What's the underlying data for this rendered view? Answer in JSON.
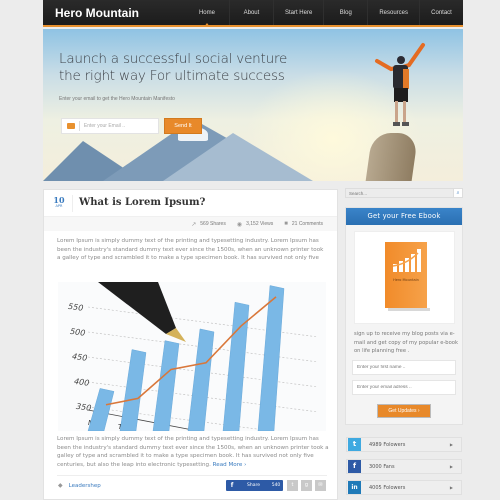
{
  "header": {
    "logo": "Hero Mountain",
    "nav": [
      {
        "label": "Home",
        "active": true
      },
      {
        "label": "About",
        "active": false
      },
      {
        "label": "Start Here",
        "active": false
      },
      {
        "label": "Blog",
        "active": false
      },
      {
        "label": "Resources",
        "active": false
      },
      {
        "label": "Contact",
        "active": false
      }
    ],
    "accent": "#e8912e"
  },
  "hero": {
    "title_line1": "Launch a successful social venture",
    "title_line2": "the right way For ultimate success",
    "subtitle": "Enter your email to get the Hero Mountain Manifesto",
    "email_placeholder": "Enter your Email ..",
    "send_label": "Send It"
  },
  "post": {
    "day": "10",
    "month": "APR",
    "title": "What is Lorem Ipsum?",
    "shares": "569 Shares",
    "views": "3,152 Views",
    "comments": "21 Comments",
    "intro": "Lorem Ipsum is simply dummy text of the printing and typesetting industry. Lorem Ipsum has been the industry's standard dummy text ever since the 1500s, when an unknown printer took a galley of type and scrambled it to make a type specimen book. It has survived not only five",
    "body": "Lorem Ipsum is simply dummy text of the printing and typesetting industry. Lorem Ipsum has been the industry's standard dummy text ever since the 1500s, when an unknown printer took a galley of type and scrambled it to make a type specimen book. It has survived not only five centuries, but also the leap into electronic typesetting.",
    "read_more": "Read More ›",
    "tag": "Leadershep",
    "share_label": "Share",
    "share_count": "540",
    "image": {
      "y_ticks": [
        "550",
        "500",
        "450",
        "400",
        "350"
      ],
      "x_ticks": [
        "M",
        "T"
      ],
      "bars": [
        380,
        450,
        460,
        475,
        520,
        545
      ],
      "line": [
        355,
        360,
        410,
        415,
        480,
        530
      ],
      "colors": {
        "bar": "#7ab8e6",
        "line": "#d9773a"
      }
    }
  },
  "sidebar": {
    "search_placeholder": "Search...",
    "widget_title": "Get  your Free Ebook",
    "book_title": "Hero Mountain",
    "widget_text": "sign up to receive my blog posts via e-mail and get  copy of my popular e-book on life planning free .",
    "first_name_placeholder": "Enter your first name ..",
    "email_placeholder": "Enter your email adress ..",
    "button_label": "Get Updates ›",
    "social": [
      {
        "network": "twitter",
        "label": "4989 Folowers",
        "color": "#3fa9e0",
        "glyph": "t"
      },
      {
        "network": "facebook",
        "label": "3000 Fans",
        "color": "#2d5aa6",
        "glyph": "f"
      },
      {
        "network": "linkedin",
        "label": "4005 Folowers",
        "color": "#1f7ab8",
        "glyph": "in"
      }
    ]
  }
}
